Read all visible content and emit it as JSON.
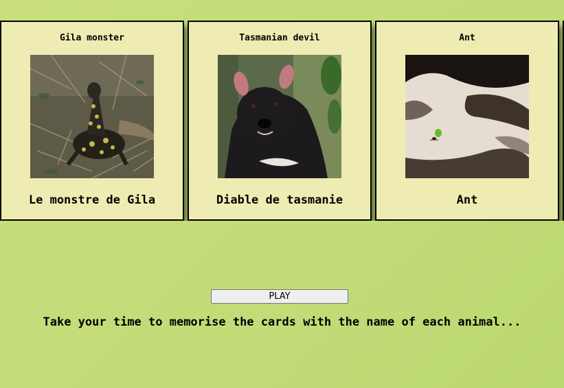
{
  "cards": [
    {
      "title": "Gila monster",
      "name": "Le monstre de Gila",
      "image": "gila-monster-photo"
    },
    {
      "title": "Tasmanian devil",
      "name": "Diable de tasmanie",
      "image": "tasmanian-devil-photo"
    },
    {
      "title": "Ant",
      "name": "Ant",
      "image": "ant-photo"
    }
  ],
  "controls": {
    "play_label": "PLAY"
  },
  "instructions": "Take your time to memorise the cards with the name of each animal...",
  "colors": {
    "background": "#c4dd7a",
    "card_background": "#eeecb2",
    "card_border": "#000000",
    "button_background": "#efefef"
  }
}
